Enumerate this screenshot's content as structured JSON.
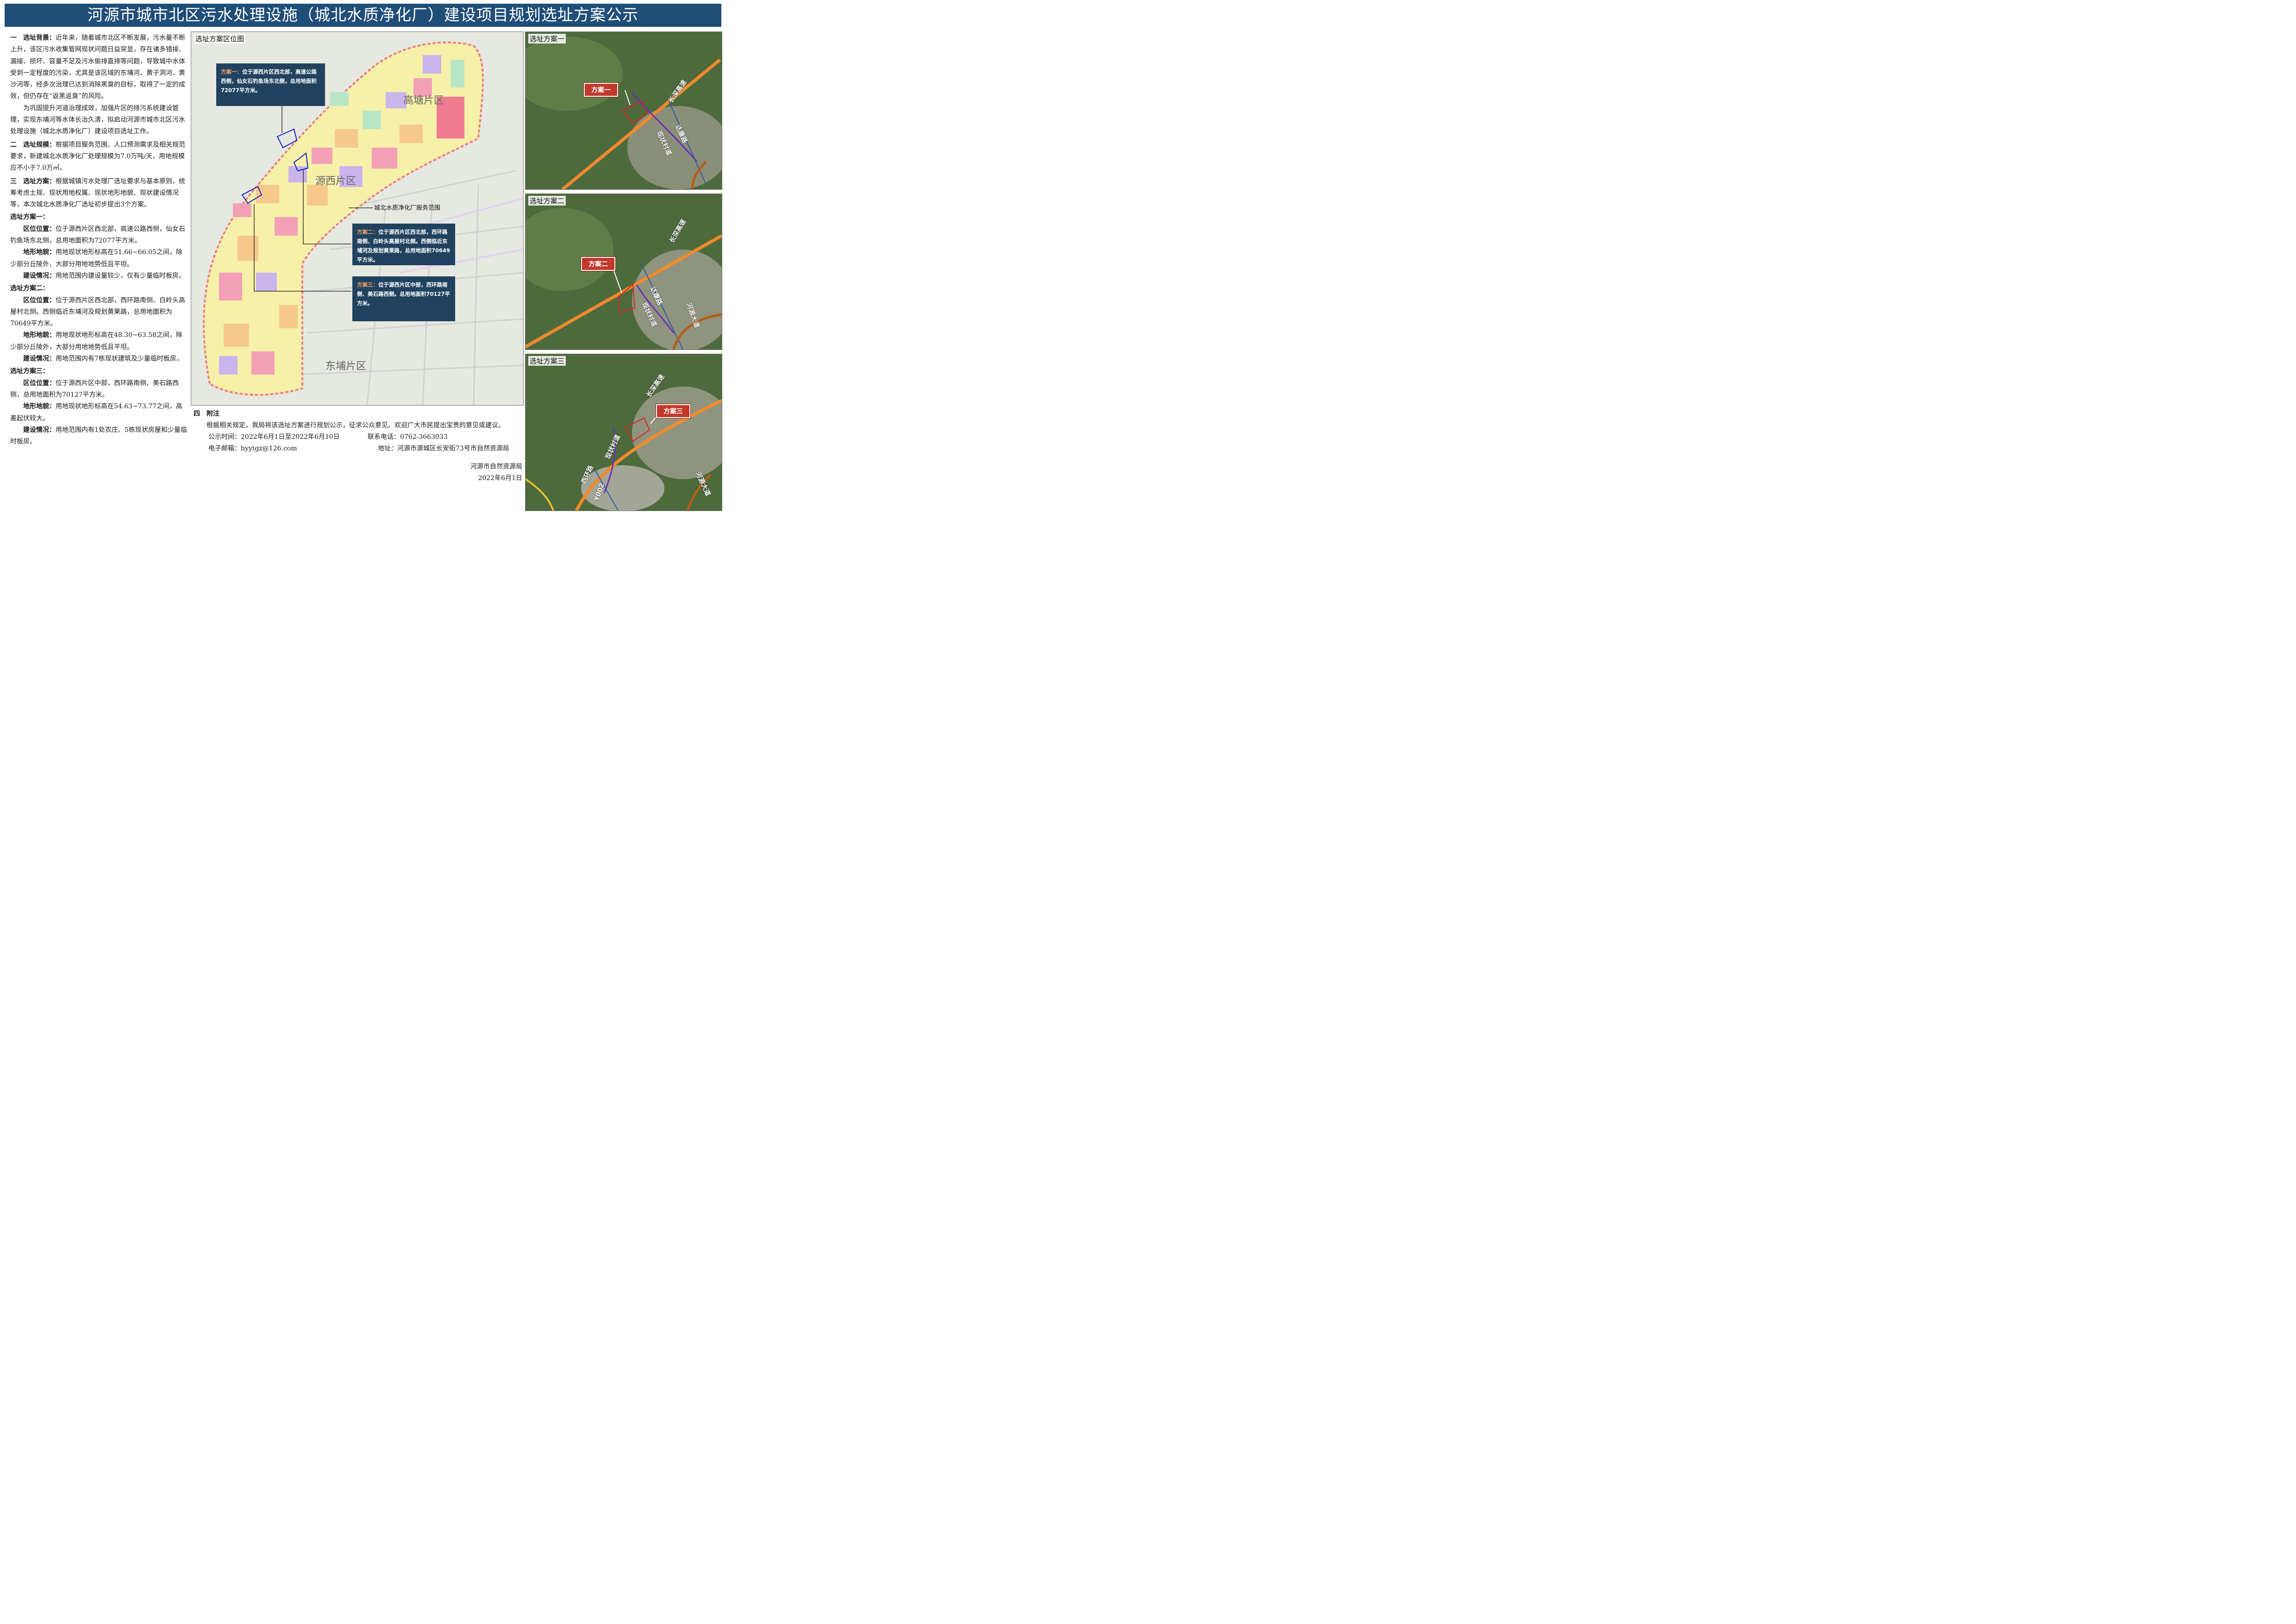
{
  "title": "河源市城市北区污水处理设施（城北水质净化厂）建设项目规划选址方案公示",
  "left": {
    "s1_head": "一　选址背景：",
    "s1_text": "近年来，随着城市北区不断发展，污水量不断上升，该区污水收集管网现状问题日益突显，存在诸多错接、漏接、损坏、容量不足及污水偷排直排等问题，导致城中水体受到一定程度的污染，尤其是该区域的东埔河、黄子洞河、黄沙河等，经多次治理已达到消除黑臭的目标，取得了一定的成效，但仍存在“返黑返臭”的风险。",
    "s1_p2": "为巩固提升河道治理成效，加强片区的排污系统建设管理，实现东埔河等水体长治久清，拟启动河源市城市北区污水处理设施（城北水质净化厂）建设项目选址工作。",
    "s2_head": "二　选址规模：",
    "s2_text": "根据项目服务范围、人口预测需求及相关规范要求，新建城北水质净化厂处理规模为7.0万吨/天，用地规模应不小于7.0万㎡。",
    "s3_head": "三　选址方案：",
    "s3_text": "根据城镇污水处理厂选址要求与基本原则，统筹考虑土规、现状用地权属、现状地形地貌、现状建设情况等，本次城北水质净化厂选址初步提出3个方案。",
    "label_loc": "区位位置：",
    "label_terrain": "地形地貌：",
    "label_build": "建设情况：",
    "p1": {
      "head": "选址方案一：",
      "loc": "位于源西片区西北部，高速公路西侧，仙女石钓鱼场东北侧，总用地面积为72077平方米。",
      "terrain": "用地现状地形标高在51.66~66.05之间，除少部分丘陵外，大部分用地地势低且平坦。",
      "build": "用地范围内建设量较少，仅有少量临时板房。"
    },
    "p2": {
      "head": "选址方案二：",
      "loc": "位于源西片区西北部，西环路南侧、白岭头高屋村北侧。西侧临近东埔河及规划黄果路，总用地面积为70649平方米。",
      "terrain": "用地现状地形标高在48.30~63.58之间，除少部分丘陵外，大部分用地地势低且平坦。",
      "build": "用地范围内有7栋现状建筑及少量临时板房。"
    },
    "p3": {
      "head": "选址方案三：",
      "loc": "位于源西片区中部，西环路南侧、美石路西侧，总用地面积为70127平方米。",
      "terrain": "用地现状地形标高在54.63~73.77之间，高差起伏较大。",
      "build": "用地范围内有1处农庄、5栋现状房屋和少量临时板房。"
    }
  },
  "map": {
    "title": "选址方案区位图",
    "zone_gaotang": "高塘片区",
    "zone_yuanxi": "源西片区",
    "zone_dongbu": "东埔片区",
    "service_label": "城北水质净化厂服务范围",
    "c1_key": "方案一：",
    "c1_text": "位于源西片区西北部，高速公路西侧，仙女石钓鱼场东北侧，总用地面积72077平方米。",
    "c2_key": "方案二：",
    "c2_text": "位于源西片区西北部，西环路南侧、白岭头高屋村北侧。西侧临近东埔河及规划黄果路，总用地面积70649平方米。",
    "c3_key": "方案三：",
    "c3_text": "位于源西片区中部，西环路南侧、美石路西侧。总用地面积70127平方米。"
  },
  "sat1": {
    "title": "选址方案一",
    "bubble": "方案一",
    "r_highway": "长深高速",
    "r_daikang": "达康路",
    "r_village": "现状村道"
  },
  "sat2": {
    "title": "选址方案二",
    "bubble": "方案二",
    "r_highway": "长深高速",
    "r_daikang": "达康路",
    "r_village": "现状村道",
    "r_heyuan": "河源大道"
  },
  "sat3": {
    "title": "选址方案三",
    "bubble": "方案三",
    "r_highway": "长深高速",
    "r_village": "现状村道",
    "r_xihuan": "西环路",
    "r_y002": "Y002",
    "r_heyuan": "河源大道"
  },
  "notes": {
    "head": "四　附注",
    "text": "根据相关规定，我局将该选址方案进行规划公示，征求公众意见。欢迎广大市民提出宝贵的意见或建议。",
    "time_label": "公示时间：",
    "time": "2022年6月1日至2022年6月10日",
    "phone_label": "联系电话：",
    "phone": "0762-3663033",
    "email_label": "电子邮箱：",
    "email": "hyytgz@126.com",
    "addr_label": "地址：",
    "addr": "河源市源城区长安街73号市自然资源局",
    "org": "河源市自然资源局",
    "date": "2022年6月1日"
  },
  "colors": {
    "banner": "#1f4e79",
    "callout": "#20425f",
    "callout_key": "#f4a06a",
    "bubble": "#c0392b",
    "highway": "#f28a2e",
    "village_road": "#6a2fb5"
  }
}
